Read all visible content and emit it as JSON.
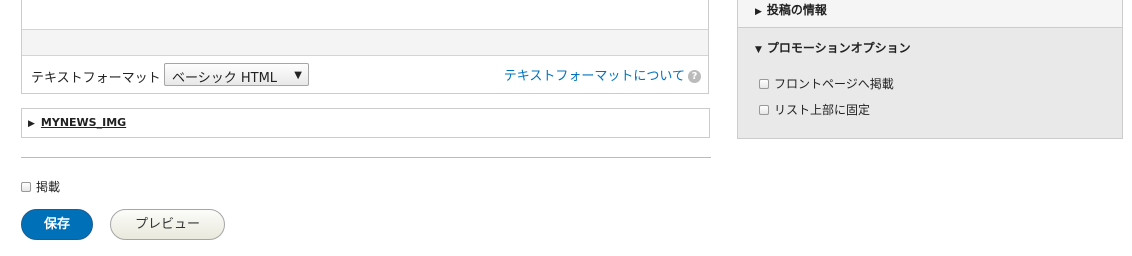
{
  "editor": {
    "format_label": "テキストフォーマット",
    "format_select": {
      "value": "ベーシック HTML",
      "arrow": "▼"
    },
    "format_help": {
      "link": "テキストフォーマットについて",
      "icon": "?"
    }
  },
  "details": {
    "toggle": "▶",
    "label": "MYNEWS_IMG"
  },
  "publish": {
    "label": "掲載",
    "checked": false
  },
  "actions": {
    "save_label": "保存",
    "preview_label": "プレビュー",
    "save_color": "#0071b8"
  },
  "sidebar": {
    "authoring_info": {
      "toggle": "▶",
      "label": "投稿の情報"
    },
    "promotion": {
      "toggle": "▼",
      "label": "プロモーションオプション",
      "options": [
        {
          "label": "フロントページへ掲載",
          "checked": false
        },
        {
          "label": "リスト上部に固定",
          "checked": false
        }
      ]
    }
  }
}
